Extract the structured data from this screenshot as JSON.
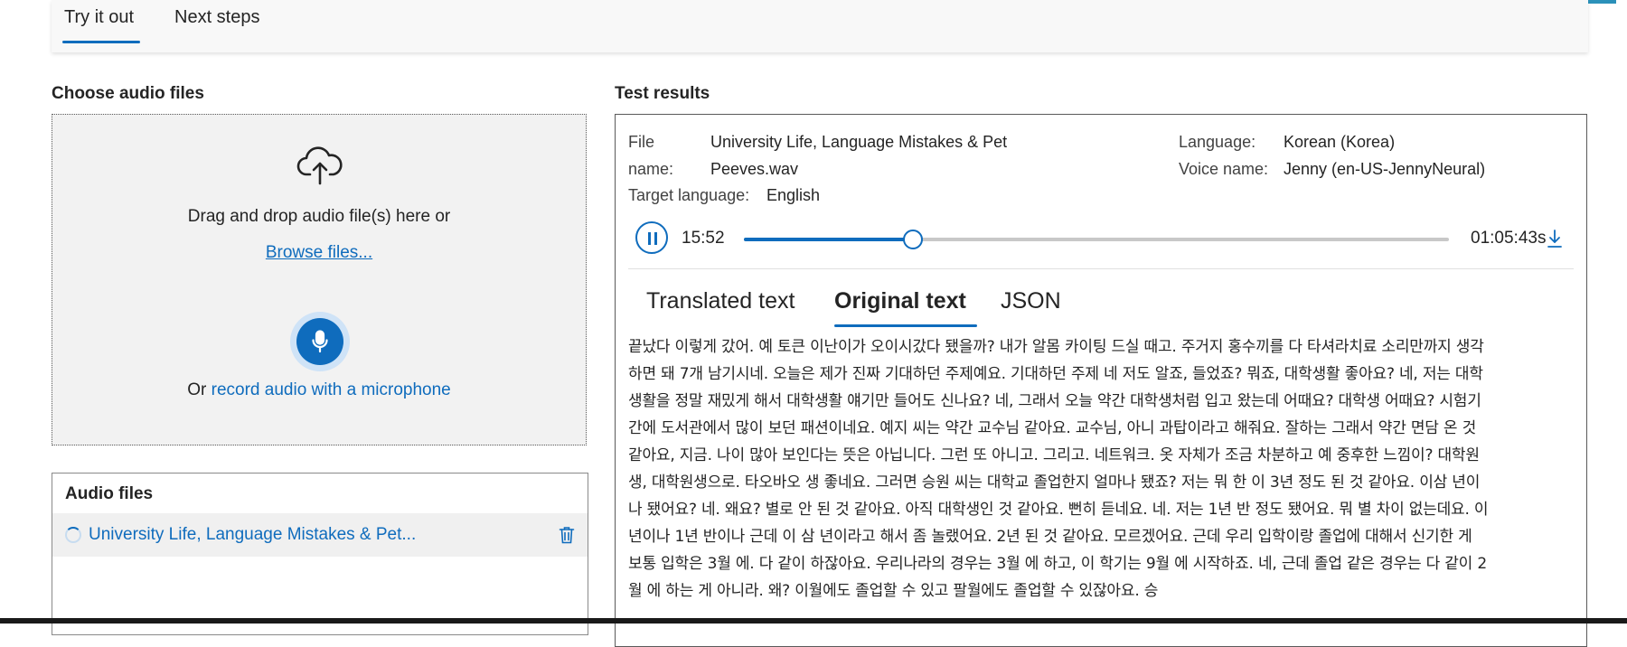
{
  "top_tabs": [
    {
      "label": "Try it out",
      "active": true
    },
    {
      "label": "Next steps",
      "active": false
    }
  ],
  "left": {
    "section_title": "Choose audio files",
    "dropzone": {
      "icon": "cloud-upload-icon",
      "drag_text": "Drag and drop audio file(s) here or",
      "browse_link": "Browse files...",
      "mic_icon": "microphone-icon",
      "or_text": "Or",
      "record_link": "record audio with a microphone"
    },
    "audio_files": {
      "title": "Audio files",
      "items": [
        {
          "name": "University Life, Language Mistakes & Pet..."
        }
      ]
    }
  },
  "results": {
    "section_title": "Test results",
    "file_name_label_1": "File",
    "file_name_label_2": "name:",
    "file_name_value_1": "University Life, Language Mistakes & Pet",
    "file_name_value_2": "Peeves.wav",
    "language_label": "Language:",
    "language_value": "Korean (Korea)",
    "voice_label": "Voice name:",
    "voice_value": "Jenny (en-US-JennyNeural)",
    "target_label": "Target language:",
    "target_value": "English",
    "player": {
      "current_time": "15:52",
      "total_time": "01:05:43s",
      "progress": 0.24
    },
    "tabs": [
      {
        "label": "Translated text",
        "active": false
      },
      {
        "label": "Original text",
        "active": true
      },
      {
        "label": "JSON",
        "active": false
      }
    ],
    "transcript_lines": [
      "끝났다 이렇게 갔어. 예 토큰 이난이가 오이시갔다 됐을까? 내가 알몸 카이팅 드실 때고. 주거지 홍수끼를 다 타셔라치료 소리만까지 생각",
      "하면 돼 7개 남기시네. 오늘은 제가 진짜 기대하던 주제예요. 기대하던 주제 네 저도 알죠, 들었죠? 뭐죠, 대학생활 좋아요? 네, 저는 대학",
      "생활을 정말 재밌게 해서 대학생활 얘기만 들어도 신나요? 네, 그래서 오늘 약간 대학생처럼 입고 왔는데 어때요? 대학생 어때요? 시험기",
      "간에 도서관에서 많이 보던 패션이네요. 예지 씨는 약간 교수님 같아요. 교수님, 아니 과탑이라고 해줘요. 잘하는 그래서 약간 면담 온 것",
      "같아요, 지금. 나이 많아 보인다는 뜻은 아닙니다. 그런 또 아니고. 그리고. 네트워크. 옷 자체가 조금 차분하고 예 중후한 느낌이? 대학원",
      "생, 대학원생으로. 타오바오 생 좋네요. 그러면 승원 씨는 대학교 졸업한지 얼마나 됐죠? 저는 뭐 한 이 3년 정도 된 것 같아요. 이삼 년이",
      "나 됐어요? 네. 왜요? 별로 안 된 것 같아요. 아직 대학생인 것 같아요. 뻔히 듣네요. 네. 저는 1년 반 정도 됐어요. 뭐 별 차이 없는데요. 이",
      "년이나 1년 반이나 근데 이 삼 년이라고 해서 좀 놀랬어요. 2년 된 것 같아요. 모르겠어요. 근데 우리 입학이랑 졸업에 대해서 신기한 게",
      "보통 입학은 3월 에. 다 같이 하잖아요. 우리나라의 경우는 3월 에 하고, 이 학기는 9월 에 시작하죠. 네, 근데 졸업 같은 경우는 다 같이 2",
      "월 에 하는 게 아니라. 왜? 이월에도 졸업할 수 있고 팔월에도 졸업할 수 있잖아요. 승"
    ]
  },
  "colors": {
    "accent": "#0f6cbd",
    "text": "#242424"
  }
}
